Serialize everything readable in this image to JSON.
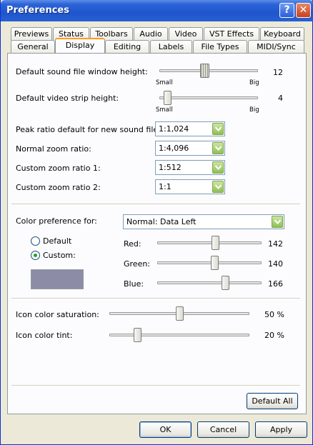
{
  "window": {
    "title": "Preferences",
    "help_icon": "help-icon",
    "close_icon": "close-icon"
  },
  "tabs_back": [
    "Previews",
    "Status",
    "Toolbars",
    "Audio",
    "Video",
    "VST Effects",
    "Keyboard"
  ],
  "tabs_front": [
    "General",
    "Display",
    "Editing",
    "Labels",
    "File Types",
    "MIDI/Sync"
  ],
  "active_tab": "Display",
  "display": {
    "sound_height": {
      "label": "Default sound file window height:",
      "min_label": "Small",
      "max_label": "Big",
      "value": "12",
      "level": 0.46
    },
    "video_height": {
      "label": "Default video strip height:",
      "min_label": "Small",
      "max_label": "Big",
      "value": "4",
      "level": 0.08
    },
    "peak_ratio": {
      "label": "Peak ratio default for new sound files:",
      "selected": "1:1,024"
    },
    "normal_zoom": {
      "label": "Normal zoom ratio:",
      "selected": "1:4,096"
    },
    "custom_zoom_1": {
      "label": "Custom zoom ratio 1:",
      "selected": "1:512"
    },
    "custom_zoom_2": {
      "label": "Custom zoom ratio 2:",
      "selected": "1:1"
    },
    "color_pref": {
      "label": "Color preference for:",
      "selected": "Normal: Data Left",
      "radio_default": "Default",
      "radio_custom": "Custom:",
      "selected_radio": "custom",
      "swatch_color": "#8c8ca6",
      "red": {
        "label": "Red:",
        "value": "142",
        "level": 0.557
      },
      "green": {
        "label": "Green:",
        "value": "140",
        "level": 0.549
      },
      "blue": {
        "label": "Blue:",
        "value": "166",
        "level": 0.651
      }
    },
    "icon_saturation": {
      "label": "Icon color saturation:",
      "value": "50 %",
      "level": 0.5
    },
    "icon_tint": {
      "label": "Icon color tint:",
      "value": "20 %",
      "level": 0.2
    },
    "default_all_label": "Default All"
  },
  "footer": {
    "ok_label": "OK",
    "cancel_label": "Cancel",
    "apply_label": "Apply"
  },
  "colors": {
    "accent_tab": "#ff9a1e",
    "title_bar": "#2c64d8",
    "combo_button": "#8fbf55",
    "radio_dot": "#21a121"
  }
}
